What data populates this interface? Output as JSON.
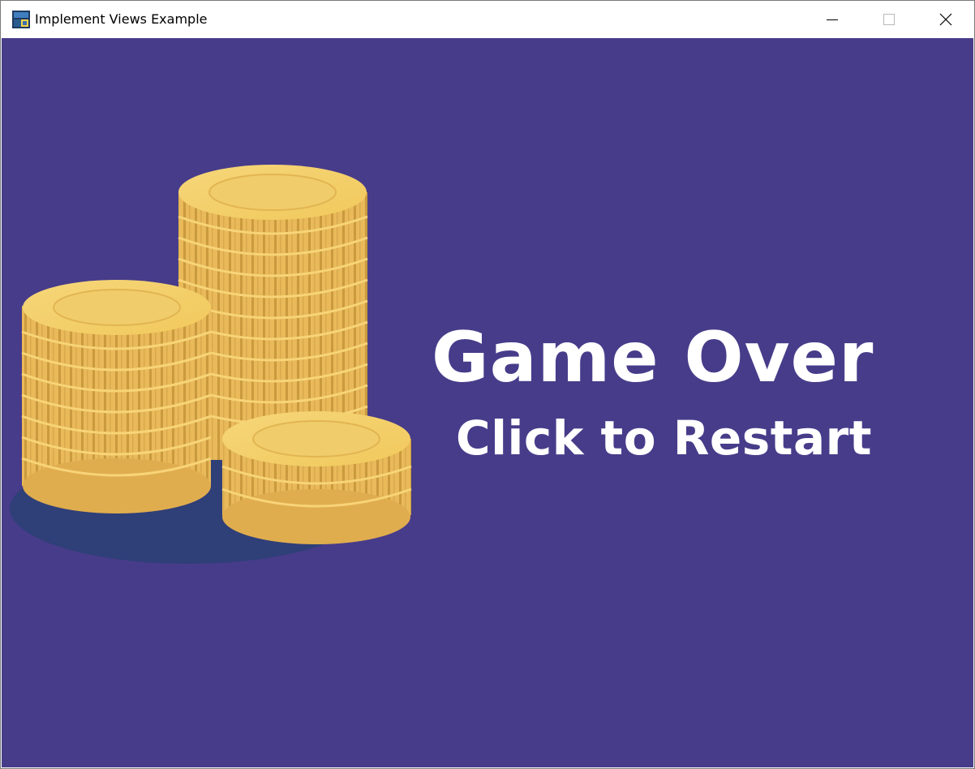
{
  "window": {
    "title": "Implement Views Example",
    "app_icon": "python-app-icon",
    "controls": {
      "minimize_icon": "minimize-icon",
      "maximize_icon": "maximize-icon",
      "close_icon": "close-icon"
    }
  },
  "game": {
    "background_color": "#473c8a",
    "title": "Game Over",
    "subtitle": "Click to Restart",
    "illustration": "coin-stacks-icon",
    "text_color": "#ffffff",
    "coin_color": "#f2c45e"
  }
}
